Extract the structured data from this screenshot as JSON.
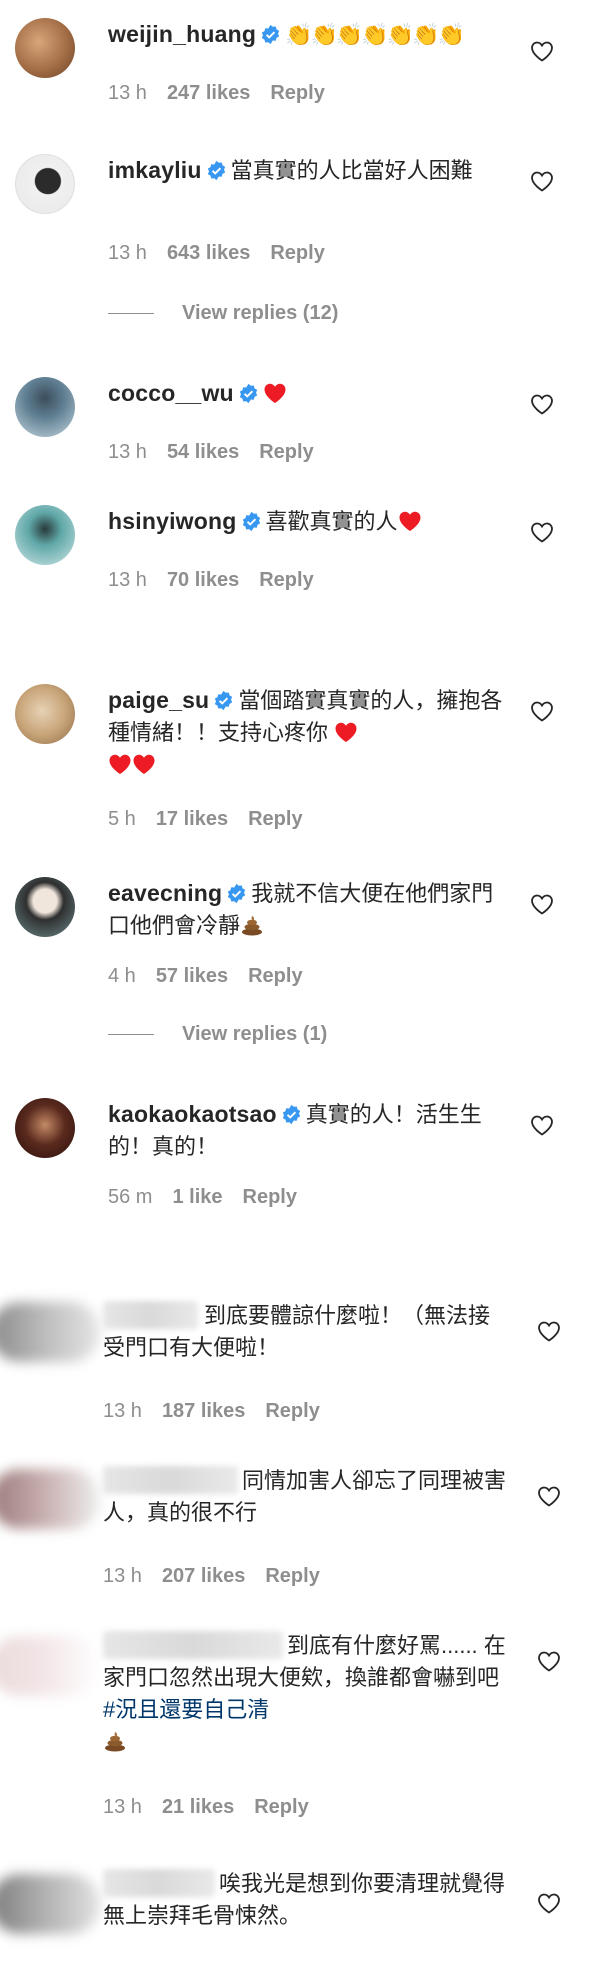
{
  "comments": [
    {
      "username": "weijin_huang",
      "verified": true,
      "text": "",
      "emoji": "clap-x7",
      "time": "13 h",
      "likes": "247 likes",
      "reply": "Reply",
      "avatar_color": "#b07a55"
    },
    {
      "username": "imkayliu",
      "verified": true,
      "text": "當真實的人比當好人困難",
      "time": "13 h",
      "likes": "643 likes",
      "reply": "Reply",
      "view_replies": "View replies (12)",
      "avatar_color": "#dcdcdc"
    },
    {
      "username": "cocco__wu",
      "verified": true,
      "text": "",
      "time": "13 h",
      "likes": "54 likes",
      "reply": "Reply",
      "avatar_color": "#6f8fa3"
    },
    {
      "username": "hsinyiwong",
      "verified": true,
      "text": "喜歡真實的人",
      "time": "13 h",
      "likes": "70 likes",
      "reply": "Reply",
      "avatar_color": "#7fbfbf"
    },
    {
      "username": "paige_su",
      "verified": true,
      "text": "當個踏實真實的人，擁抱各種情緒！！支持心疼你",
      "time": "5 h",
      "likes": "17 likes",
      "reply": "Reply",
      "avatar_color": "#c9a57a"
    },
    {
      "username": "eavecning",
      "verified": true,
      "text": "我就不信大便在他們家門口他們會冷靜",
      "time": "4 h",
      "likes": "57 likes",
      "reply": "Reply",
      "view_replies": "View replies (1)",
      "avatar_color": "#3b3b3b"
    },
    {
      "username": "kaokaokaotsao",
      "verified": true,
      "text": "真實的人！活生生的！真的！",
      "time": "56 m",
      "likes": "1 like",
      "reply": "Reply",
      "avatar_color": "#5a2a1e"
    },
    {
      "username": "",
      "verified": false,
      "text": "到底要體諒什麼啦！（無法接受門口有大便啦！",
      "time": "13 h",
      "likes": "187 likes",
      "reply": "Reply",
      "avatar_color": "#9a9a9a"
    },
    {
      "username": "",
      "verified": false,
      "text": "同情加害人卻忘了同理被害人，真的很不行",
      "time": "13 h",
      "likes": "207 likes",
      "reply": "Reply",
      "avatar_color": "#b89a9a"
    },
    {
      "username": "",
      "verified": false,
      "text": "到底有什麼好罵...... 在家門口忽然出現大便欸，換誰都會嚇到吧 ",
      "hashtag": "#況且還要自己清",
      "time": "13 h",
      "likes": "21 likes",
      "reply": "Reply",
      "avatar_color": "#e2c9cc"
    },
    {
      "username": "",
      "verified": false,
      "text": "唉我光是想到你要清理就覺得無上崇拜毛骨悚然。",
      "avatar_color": "#8d8d8d"
    }
  ],
  "colors": {
    "verified": "#3897f0",
    "meta": "#8e8e8e",
    "text": "#262626",
    "hashtag": "#00376b",
    "heart_red": "#ed1c24"
  },
  "icons": {
    "heart_outline": "heart-icon",
    "verified": "verified-badge-icon"
  }
}
